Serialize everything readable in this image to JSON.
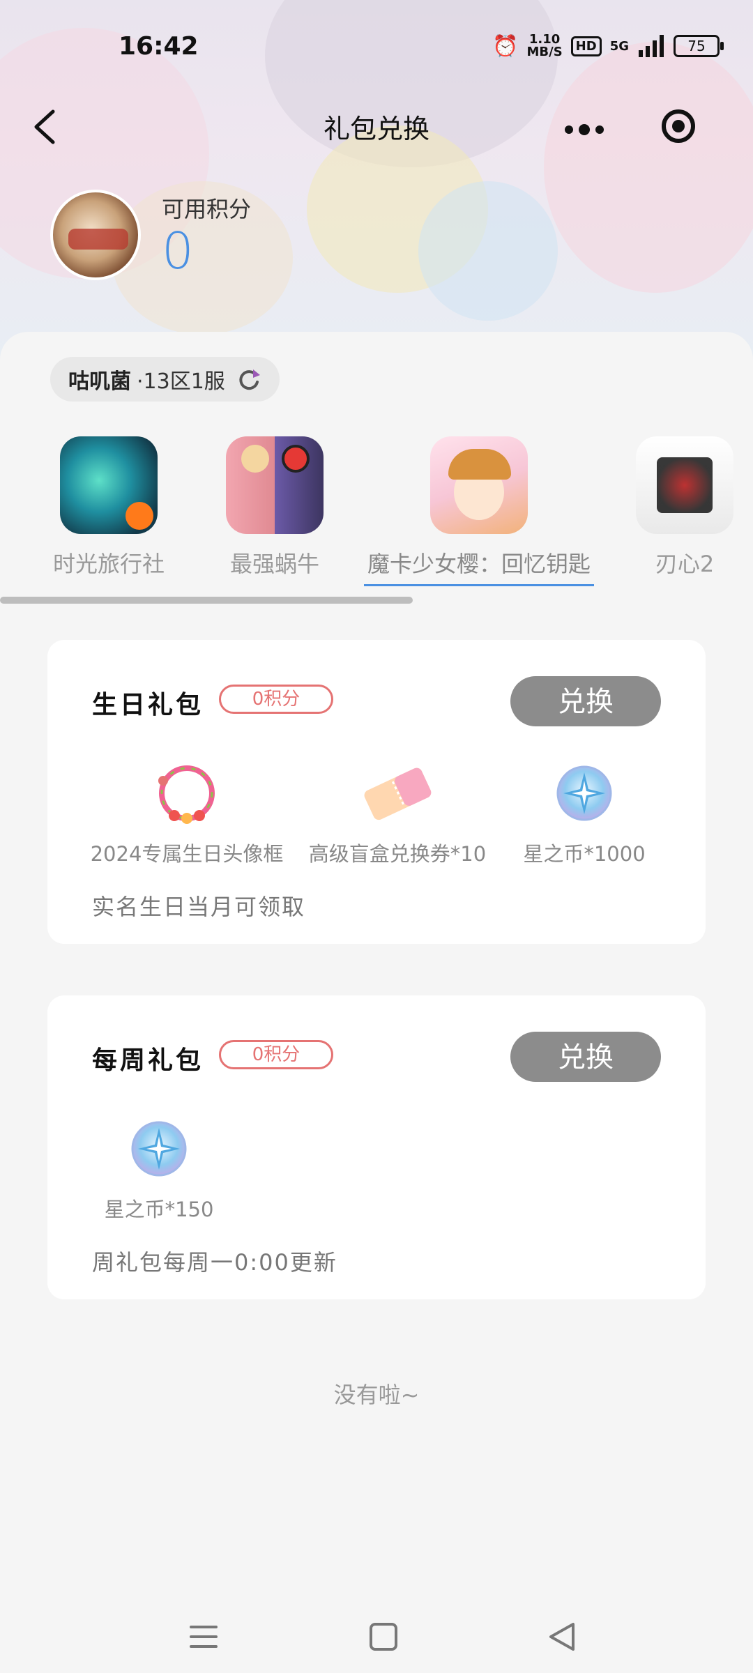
{
  "status_bar": {
    "time": "16:42",
    "speed_value": "1.10",
    "speed_unit": "MB/S",
    "hd_label": "HD",
    "network": "5G",
    "battery": "75"
  },
  "nav": {
    "title": "礼包兑换"
  },
  "points": {
    "label": "可用积分",
    "value": "0"
  },
  "server": {
    "name": "咕叽菌",
    "zone": "·13区1服"
  },
  "games": [
    {
      "name": "时光旅行社"
    },
    {
      "name": "最强蜗牛"
    },
    {
      "name": "魔卡少女樱：回忆钥匙",
      "active": true
    },
    {
      "name": "刃心2"
    }
  ],
  "cards": [
    {
      "title": "生日礼包",
      "cost": "0积分",
      "button": "兑换",
      "items": [
        {
          "label": "2024专属生日头像框"
        },
        {
          "label": "高级盲盒兑换券*10"
        },
        {
          "label": "星之币*1000"
        }
      ],
      "note": "实名生日当月可领取"
    },
    {
      "title": "每周礼包",
      "cost": "0积分",
      "button": "兑换",
      "items": [
        {
          "label": "星之币*150"
        }
      ],
      "note": "周礼包每周一0:00更新"
    }
  ],
  "end_text": "没有啦~",
  "colors": {
    "accent": "#4a90e2",
    "badge": "#e57373",
    "button_bg": "#8c8c8c"
  }
}
